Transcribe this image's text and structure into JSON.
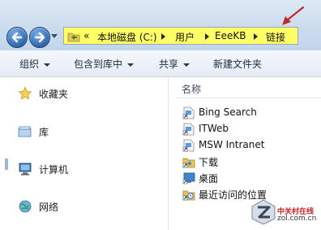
{
  "address": {
    "overflow": "«",
    "crumbs": [
      "本地磁盘 (C:)",
      "用户",
      "EeeKB",
      "链接"
    ]
  },
  "toolbar": {
    "organize": "组织",
    "include_in_library": "包含到库中",
    "share": "共享",
    "new_folder": "新建文件夹"
  },
  "navpane": {
    "favorites": "收藏夹",
    "libraries": "库",
    "computer": "计算机",
    "network": "网络"
  },
  "content": {
    "column_header": "名称",
    "items": [
      "Bing Search",
      "ITWeb",
      "MSW Intranet",
      "下载",
      "桌面",
      "最近访问的位置"
    ]
  },
  "watermark": {
    "brand_cn": "中关村在线",
    "domain": "zol.com.cn"
  },
  "colors": {
    "address_highlight": "#ffff66",
    "annotation_arrow": "#c0282d"
  }
}
